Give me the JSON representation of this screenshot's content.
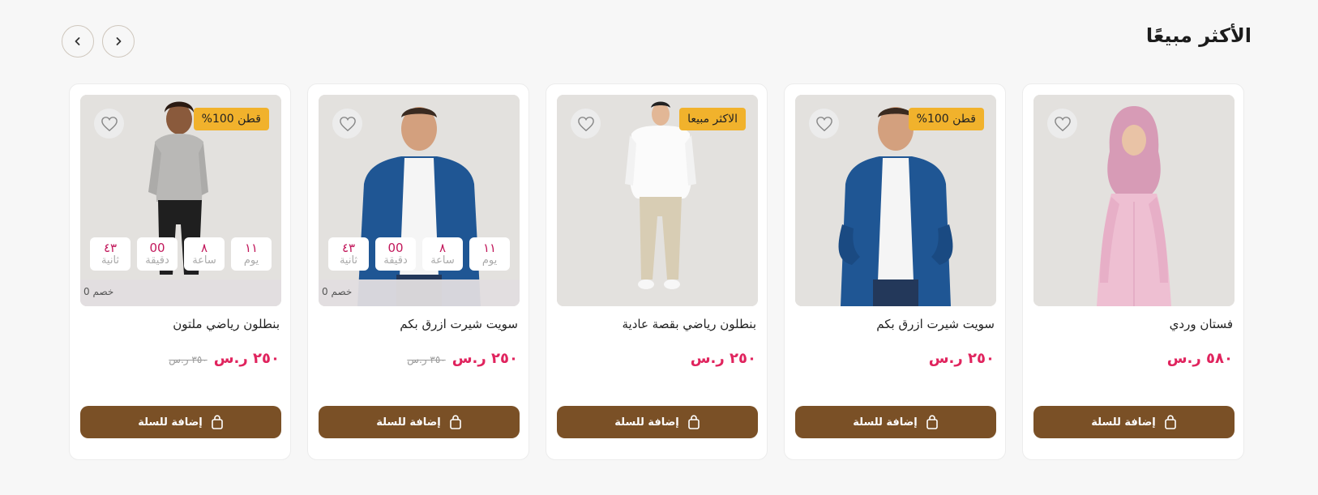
{
  "section": {
    "title": "الأكثر مبيعًا",
    "prev_icon": "chevron-left-icon",
    "next_icon": "chevron-right-icon"
  },
  "colors": {
    "accent": "#7a5026",
    "price": "#e0245e",
    "badge": "#f1b22c",
    "countdown_number": "#c2185b"
  },
  "cards": [
    {
      "name": "فستان وردي",
      "price": "٥٨٠ ر.س",
      "old_price": "",
      "badge": "",
      "add_label": "إضافة للسلة",
      "image": "woman-pink-dress"
    },
    {
      "name": "سويت شيرت ازرق بكم",
      "price": "٢٥٠ ر.س",
      "old_price": "",
      "badge": "قطن 100%",
      "add_label": "إضافة للسلة",
      "image": "man-blue-sweater"
    },
    {
      "name": "بنطلون رياضي بقصة عادية",
      "price": "٢٥٠ ر.س",
      "old_price": "",
      "badge": "الاكثر مبيعا",
      "add_label": "إضافة للسلة",
      "image": "man-white-sweatshirt"
    },
    {
      "name": "سويت شيرت ازرق بكم",
      "price": "٢٥٠ ر.س",
      "old_price": "٣٥٠ ر.س",
      "badge": "",
      "add_label": "إضافة للسلة",
      "image": "man-blue-sweater",
      "countdown": {
        "days": "١١",
        "days_label": "يوم",
        "hours": "٨",
        "hours_label": "ساعة",
        "minutes": "00",
        "minutes_label": "دقيقة",
        "seconds": "٤٣",
        "seconds_label": "ثانية"
      },
      "discount": "خصم 0"
    },
    {
      "name": "بنطلون رياضي ملتون",
      "price": "٢٥٠ ر.س",
      "old_price": "٣٥٠ ر.س",
      "badge": "قطن 100%",
      "add_label": "إضافة للسلة",
      "image": "boy-grey-hoodie",
      "countdown": {
        "days": "١١",
        "days_label": "يوم",
        "hours": "٨",
        "hours_label": "ساعة",
        "minutes": "00",
        "minutes_label": "دقيقة",
        "seconds": "٤٣",
        "seconds_label": "ثانية"
      },
      "discount": "خصم 0"
    }
  ]
}
